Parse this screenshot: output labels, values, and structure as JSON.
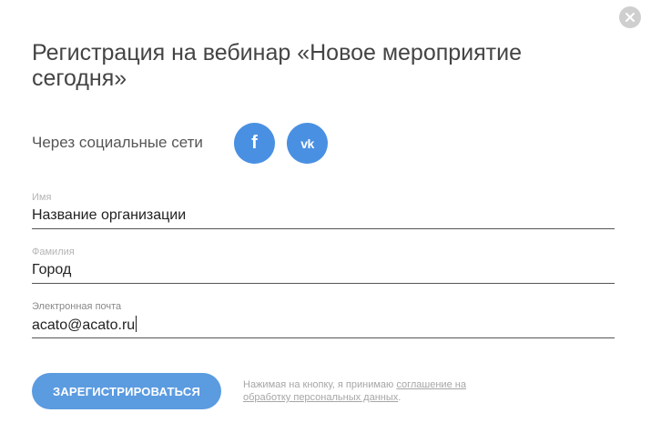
{
  "dialog": {
    "title": "Регистрация на вебинар «Новое мероприятие сегодня»",
    "close_icon": "close-icon"
  },
  "social": {
    "label": "Через социальные сети",
    "buttons": [
      {
        "name": "facebook",
        "glyph": "f",
        "icon": "facebook-icon",
        "color": "#4a90e2"
      },
      {
        "name": "vkontakte",
        "glyph": "vk",
        "icon": "vk-icon",
        "color": "#4a90e2"
      }
    ]
  },
  "form": {
    "fields": [
      {
        "label": "Имя",
        "value": "Название организации"
      },
      {
        "label": "Фамилия",
        "value": "Город"
      },
      {
        "label": "Электронная почта",
        "value": "acato@acato.ru"
      }
    ],
    "submit_label": "ЗАРЕГИСТРИРОВАТЬСЯ"
  },
  "consent": {
    "text": "Нажимая на кнопку, я принимаю ",
    "link_text": "соглашение на обработку персональных данных",
    "suffix": "."
  },
  "colors": {
    "accent": "#5b9be0",
    "social": "#4a90e2",
    "close": "#cfcfcf"
  }
}
